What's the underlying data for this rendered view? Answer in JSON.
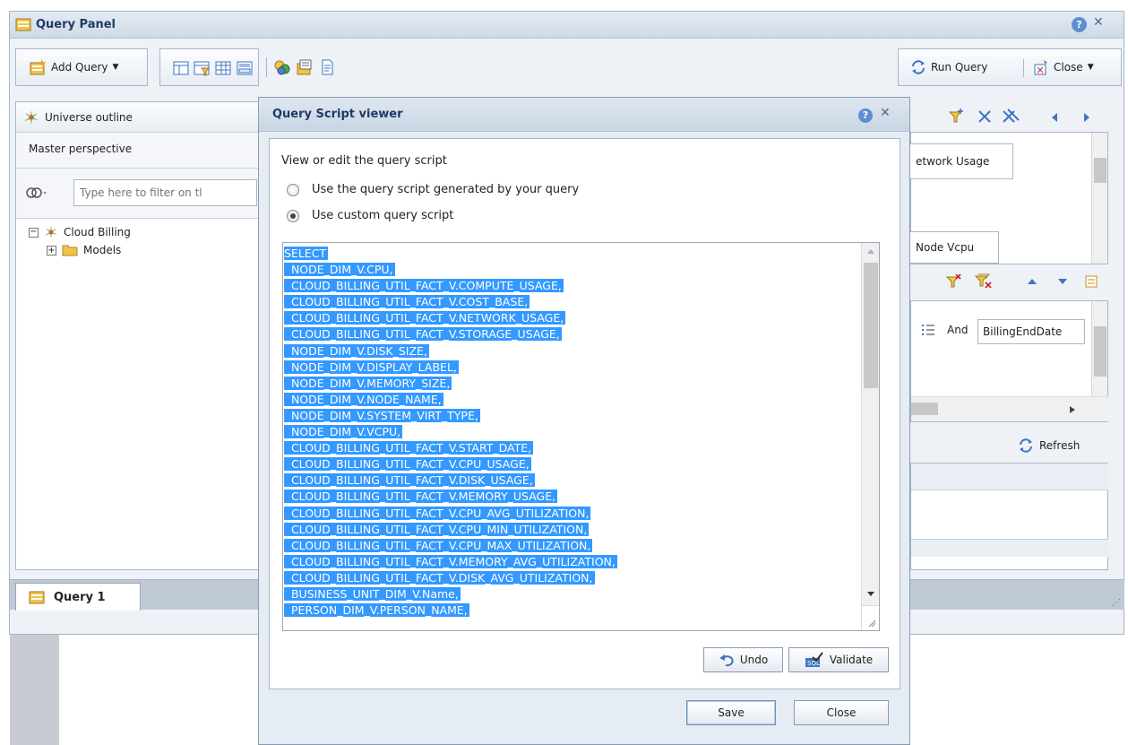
{
  "panel": {
    "title": "Query Panel",
    "help_glyph": "?",
    "close_glyph": "✕",
    "toolbar": {
      "add_query": "Add Query",
      "run_query": "Run Query",
      "close": "Close"
    },
    "left_pane": {
      "header": "Universe outline",
      "perspective": "Master perspective",
      "filter_placeholder": "Type here to filter on tl",
      "tree": [
        {
          "label": "Cloud Billing",
          "expander": "−"
        },
        {
          "label": "Models",
          "expander": "+"
        }
      ]
    },
    "right_pane": {
      "result_objects": [
        "etwork Usage",
        "Node Vcpu"
      ],
      "filter_operator": "And",
      "filter_object": "BillingEndDate",
      "refresh": "Refresh"
    },
    "tabs": [
      {
        "label": "Query 1"
      }
    ]
  },
  "dialog": {
    "title": "Query Script viewer",
    "help_glyph": "?",
    "close_glyph": "✕",
    "instruction": "View or edit the query script",
    "options": [
      {
        "label": "Use the query script generated by your query",
        "selected": false
      },
      {
        "label": "Use custom query script",
        "selected": true
      }
    ],
    "script_lines": [
      "SELECT",
      "  NODE_DIM_V.CPU,",
      "  CLOUD_BILLING_UTIL_FACT_V.COMPUTE_USAGE,",
      "  CLOUD_BILLING_UTIL_FACT_V.COST_BASE,",
      "  CLOUD_BILLING_UTIL_FACT_V.NETWORK_USAGE,",
      "  CLOUD_BILLING_UTIL_FACT_V.STORAGE_USAGE,",
      "  NODE_DIM_V.DISK_SIZE,",
      "  NODE_DIM_V.DISPLAY_LABEL,",
      "  NODE_DIM_V.MEMORY_SIZE,",
      "  NODE_DIM_V.NODE_NAME,",
      "  NODE_DIM_V.SYSTEM_VIRT_TYPE,",
      "  NODE_DIM_V.VCPU,",
      "  CLOUD_BILLING_UTIL_FACT_V.START_DATE,",
      "  CLOUD_BILLING_UTIL_FACT_V.CPU_USAGE,",
      "  CLOUD_BILLING_UTIL_FACT_V.DISK_USAGE,",
      "  CLOUD_BILLING_UTIL_FACT_V.MEMORY_USAGE,",
      "  CLOUD_BILLING_UTIL_FACT_V.CPU_AVG_UTILIZATION,",
      "  CLOUD_BILLING_UTIL_FACT_V.CPU_MIN_UTILIZATION,",
      "  CLOUD_BILLING_UTIL_FACT_V.CPU_MAX_UTILIZATION,",
      "  CLOUD_BILLING_UTIL_FACT_V.MEMORY_AVG_UTILIZATION,",
      "  CLOUD_BILLING_UTIL_FACT_V.DISK_AVG_UTILIZATION,",
      "  BUSINESS_UNIT_DIM_V.Name,",
      "  PERSON_DIM_V.PERSON_NAME,"
    ],
    "buttons": {
      "undo": "Undo",
      "validate": "Validate",
      "save": "Save",
      "close": "Close"
    }
  },
  "colors": {
    "selection": "#3399ff",
    "title_text": "#1e3b66",
    "panel_bg": "#eef2f7"
  }
}
